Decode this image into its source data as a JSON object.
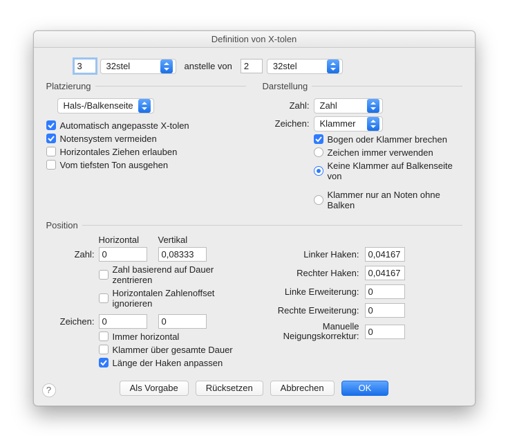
{
  "title": "Definition von X-tolen",
  "top": {
    "num1": "3",
    "unit1": "32stel",
    "instead_of": "anstelle von",
    "num2": "2",
    "unit2": "32stel"
  },
  "placement": {
    "heading": "Platzierung",
    "mode": "Hals-/Balkenseite",
    "auto": "Automatisch angepasste X-tolen",
    "avoid_staff": "Notensystem vermeiden",
    "allow_h_drag": "Horizontales Ziehen erlauben",
    "from_lowest": "Vom tiefsten Ton ausgehen"
  },
  "appearance": {
    "heading": "Darstellung",
    "number_label": "Zahl:",
    "number_value": "Zahl",
    "shape_label": "Zeichen:",
    "shape_value": "Klammer",
    "break": "Bogen oder Klammer brechen",
    "always_use": "Zeichen immer verwenden",
    "no_bracket_beam": "Keine Klammer auf Balkenseite von",
    "only_no_beam": "Klammer nur an Noten ohne Balken"
  },
  "position": {
    "heading": "Position",
    "h_head": "Horizontal",
    "v_head": "Vertikal",
    "number_label": "Zahl:",
    "number_h": "0",
    "number_v": "0,08333",
    "center_on_duration": "Zahl basierend auf Dauer zentrieren",
    "ignore_offset": "Horizontalen Zahlenoffset ignorieren",
    "shape_label": "Zeichen:",
    "shape_h": "0",
    "shape_v": "0",
    "always_horizontal": "Immer horizontal",
    "bracket_full": "Klammer über gesamte Dauer",
    "match_hooks": "Länge der Haken anpassen",
    "left_hook_label": "Linker Haken:",
    "left_hook": "0,04167",
    "right_hook_label": "Rechter Haken:",
    "right_hook": "0,04167",
    "left_ext_label": "Linke Erweiterung:",
    "left_ext": "0",
    "right_ext_label": "Rechte Erweiterung:",
    "right_ext": "0",
    "slope_label": "Manuelle Neigungskorrektur:",
    "slope": "0"
  },
  "buttons": {
    "default": "Als Vorgabe",
    "reset": "Rücksetzen",
    "cancel": "Abbrechen",
    "ok": "OK"
  }
}
